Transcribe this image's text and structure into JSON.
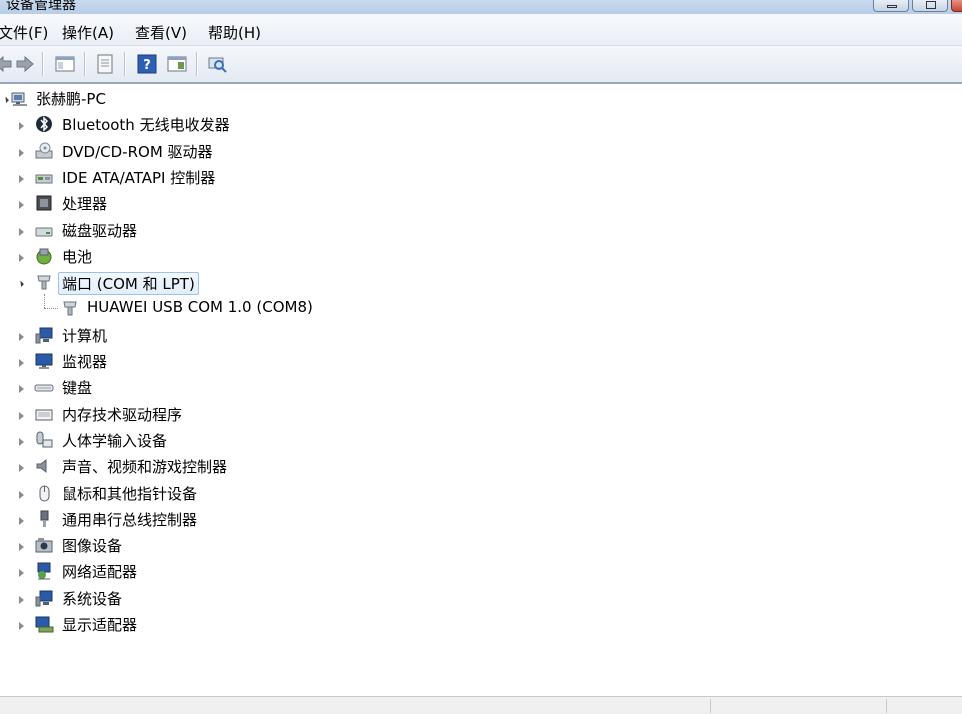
{
  "window": {
    "title": "设备管理器"
  },
  "menu": {
    "file": "文件(F)",
    "action": "操作(A)",
    "view": "查看(V)",
    "help": "帮助(H)"
  },
  "toolbar": {
    "buttons": [
      "back-icon",
      "forward-icon",
      "console-tree-icon",
      "properties-icon",
      "help-icon",
      "show-hide-icon",
      "scan-hardware-icon"
    ]
  },
  "tree": {
    "root": "张赫鹏-PC",
    "categories": [
      {
        "label": "Bluetooth 无线电收发器",
        "icon": "bluetooth-icon",
        "expanded": false
      },
      {
        "label": "DVD/CD-ROM 驱动器",
        "icon": "dvd-drive-icon",
        "expanded": false
      },
      {
        "label": "IDE ATA/ATAPI 控制器",
        "icon": "ide-controller-icon",
        "expanded": false
      },
      {
        "label": "处理器",
        "icon": "processor-icon",
        "expanded": false
      },
      {
        "label": "磁盘驱动器",
        "icon": "disk-drive-icon",
        "expanded": false
      },
      {
        "label": "电池",
        "icon": "battery-icon",
        "expanded": false
      },
      {
        "label": "端口 (COM 和 LPT)",
        "icon": "port-icon",
        "expanded": true,
        "selected": true,
        "children": [
          {
            "label": "HUAWEI USB COM 1.0 (COM8)",
            "icon": "port-icon"
          }
        ]
      },
      {
        "label": "计算机",
        "icon": "computer-icon",
        "expanded": false
      },
      {
        "label": "监视器",
        "icon": "monitor-icon",
        "expanded": false
      },
      {
        "label": "键盘",
        "icon": "keyboard-icon",
        "expanded": false
      },
      {
        "label": "内存技术驱动程序",
        "icon": "memory-icon",
        "expanded": false
      },
      {
        "label": "人体学输入设备",
        "icon": "hid-icon",
        "expanded": false
      },
      {
        "label": "声音、视频和游戏控制器",
        "icon": "sound-icon",
        "expanded": false
      },
      {
        "label": "鼠标和其他指针设备",
        "icon": "mouse-icon",
        "expanded": false
      },
      {
        "label": "通用串行总线控制器",
        "icon": "usb-icon",
        "expanded": false
      },
      {
        "label": "图像设备",
        "icon": "imaging-icon",
        "expanded": false
      },
      {
        "label": "网络适配器",
        "icon": "network-icon",
        "expanded": false
      },
      {
        "label": "系统设备",
        "icon": "system-icon",
        "expanded": false
      },
      {
        "label": "显示适配器",
        "icon": "display-adapter-icon",
        "expanded": false
      }
    ]
  }
}
